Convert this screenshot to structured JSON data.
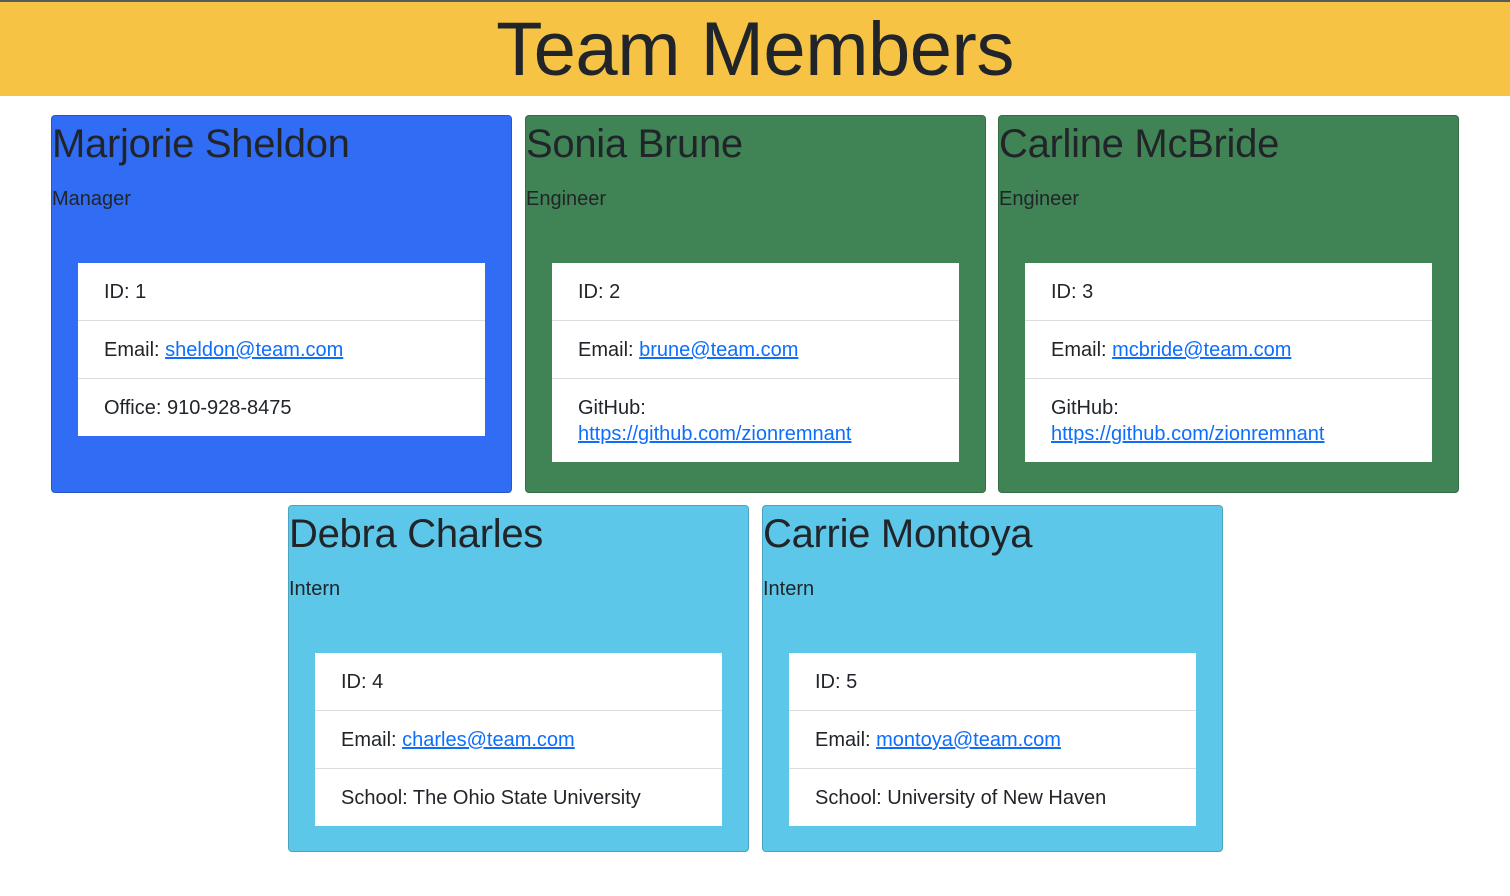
{
  "page": {
    "title": "Team Members"
  },
  "colors": {
    "header": "#f6c344",
    "manager": "#316cf4",
    "engineer": "#408455",
    "intern": "#5dc7ea",
    "link": "#0d6efd"
  },
  "members": [
    {
      "name": "Marjorie Sheldon",
      "role": "Manager",
      "id_label": "ID: 1",
      "email_prefix": "Email: ",
      "email": "sheldon@team.com",
      "extra_text": "Office: 910-928-8475"
    },
    {
      "name": "Sonia Brune",
      "role": "Engineer",
      "id_label": "ID: 2",
      "email_prefix": "Email: ",
      "email": "brune@team.com",
      "extra_prefix": "GitHub:",
      "extra_link": "https://github.com/zionremnant"
    },
    {
      "name": "Carline McBride",
      "role": "Engineer",
      "id_label": "ID: 3",
      "email_prefix": "Email: ",
      "email": "mcbride@team.com",
      "extra_prefix": "GitHub:",
      "extra_link": "https://github.com/zionremnant"
    },
    {
      "name": "Debra Charles",
      "role": "Intern",
      "id_label": "ID: 4",
      "email_prefix": "Email: ",
      "email": "charles@team.com",
      "extra_text": "School: The Ohio State University"
    },
    {
      "name": "Carrie Montoya",
      "role": "Intern",
      "id_label": "ID: 5",
      "email_prefix": "Email: ",
      "email": "montoya@team.com",
      "extra_text": "School: University of New Haven"
    }
  ]
}
